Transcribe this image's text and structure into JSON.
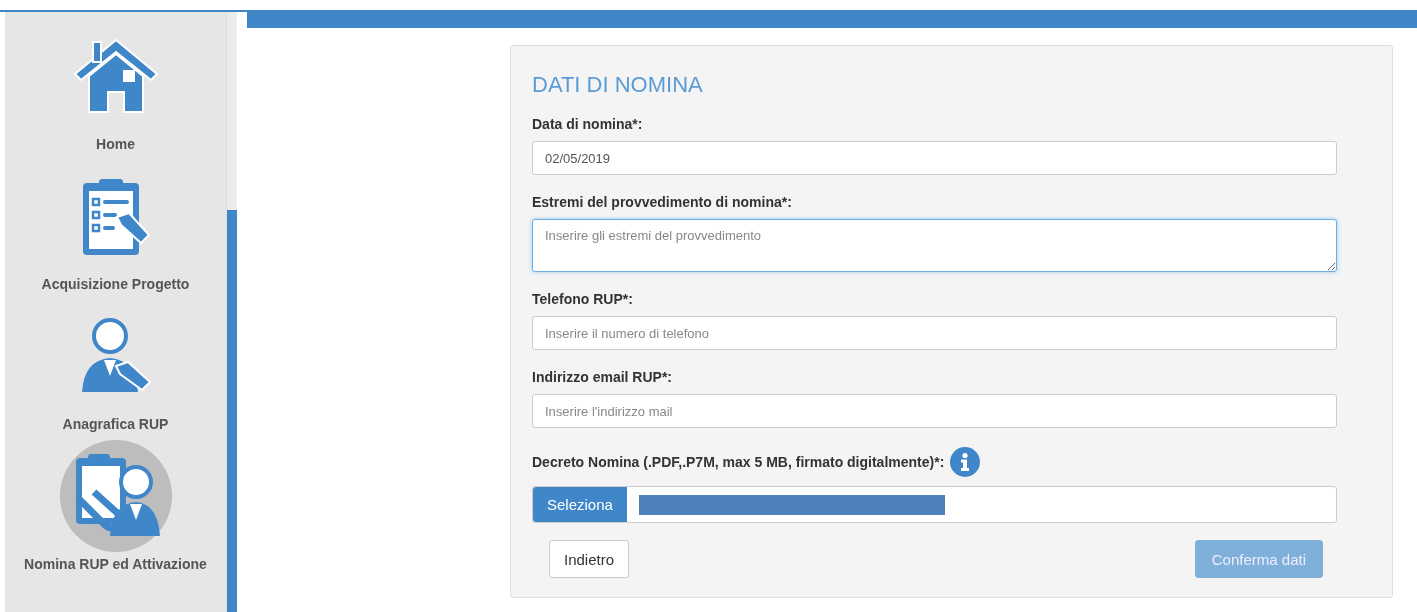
{
  "sidebar": {
    "items": [
      {
        "label": "Home",
        "selected": false
      },
      {
        "label": "Acquisizione Progetto",
        "selected": false
      },
      {
        "label": "Anagrafica RUP",
        "selected": false
      },
      {
        "label": "Nomina RUP ed Attivazione",
        "selected": true
      }
    ]
  },
  "form": {
    "title": "DATI DI NOMINA",
    "fields": [
      {
        "kind": "text",
        "label": "Data di nomina*:",
        "value": "02/05/2019",
        "focused": false
      },
      {
        "kind": "textarea",
        "label": "Estremi del provvedimento di nomina*:",
        "placeholder": "Inserire gli estremi del provvedimento",
        "focused": true
      },
      {
        "kind": "text",
        "label": "Telefono RUP*:",
        "placeholder": "Inserire il numero di telefono",
        "focused": false
      },
      {
        "kind": "text",
        "label": "Indirizzo email RUP*:",
        "placeholder": "Inserire l'indirizzo mail",
        "focused": false
      },
      {
        "kind": "file",
        "label": "Decreto Nomina (.PDF,.P7M, max 5 MB, firmato digitalmente)*:",
        "button": "Seleziona",
        "focused": false
      }
    ],
    "buttons": [
      {
        "label": "Indietro",
        "kind": "secondary",
        "disabled": false
      },
      {
        "label": "Conferma dati",
        "kind": "primary",
        "disabled": true
      }
    ]
  }
}
